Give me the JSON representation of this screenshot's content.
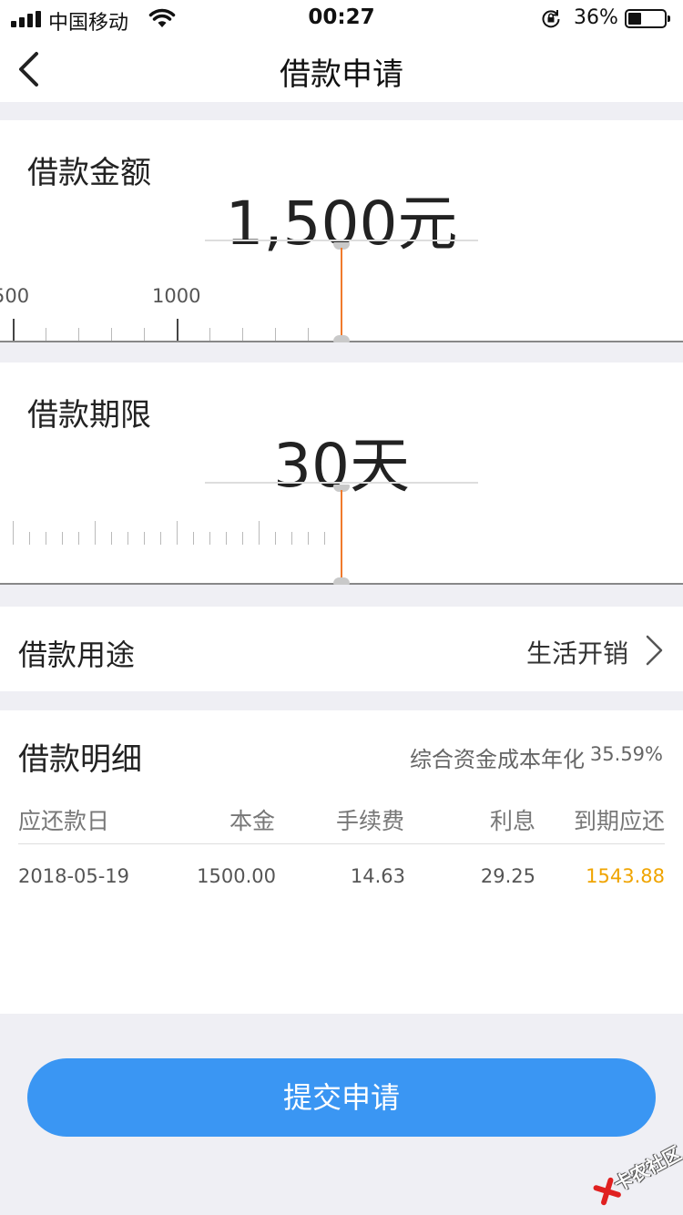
{
  "status_bar": {
    "carrier": "中国移动",
    "time": "00:27",
    "battery": "36%",
    "battery_level": 0.36
  },
  "nav": {
    "title": "借款申请"
  },
  "amount": {
    "label": "借款金额",
    "value": "1,500元",
    "ruler_labels": [
      "500",
      "1000"
    ]
  },
  "period": {
    "label": "借款期限",
    "value": "30天"
  },
  "purpose": {
    "label": "借款用途",
    "value": "生活开销"
  },
  "details": {
    "title": "借款明细",
    "rate_label": "综合资金成本年化",
    "rate_value": "35.59%",
    "columns": [
      "应还款日",
      "本金",
      "手续费",
      "利息",
      "到期应还"
    ],
    "row": [
      "2018-05-19",
      "1500.00",
      "14.63",
      "29.25",
      "1543.88"
    ],
    "highlight_color": "#f0a400"
  },
  "submit_label": "提交申请",
  "watermark": "卡农社区",
  "colors": {
    "accent": "#3a96f3",
    "indicator": "#f07a2c"
  }
}
